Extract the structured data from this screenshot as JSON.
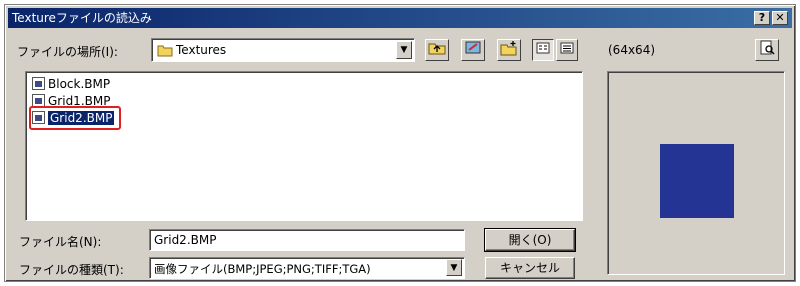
{
  "window": {
    "title": "Textureファイルの読込み",
    "help_label": "?",
    "close_label": "✕"
  },
  "location": {
    "label": "ファイルの場所(I):",
    "value": "Textures"
  },
  "preview": {
    "size_text": "(64x64)",
    "swatch_color": "#243494"
  },
  "files": [
    {
      "name": "Block.BMP",
      "selected": false
    },
    {
      "name": "Grid1.BMP",
      "selected": false
    },
    {
      "name": "Grid2.BMP",
      "selected": true
    }
  ],
  "filename": {
    "label": "ファイル名(N):",
    "value": "Grid2.BMP"
  },
  "filetype": {
    "label": "ファイルの種類(T):",
    "value": "画像ファイル(BMP;JPEG;PNG;TIFF;TGA)"
  },
  "buttons": {
    "open_label": "開く(O)",
    "cancel_label": "キャンセル"
  },
  "icons": {
    "folder": "folder-icon",
    "up": "up-folder-icon",
    "desktop": "desktop-icon",
    "new_folder": "new-folder-icon",
    "list_view": "list-view-icon",
    "details_view": "details-view-icon",
    "preview_toggle": "preview-toggle-icon"
  }
}
